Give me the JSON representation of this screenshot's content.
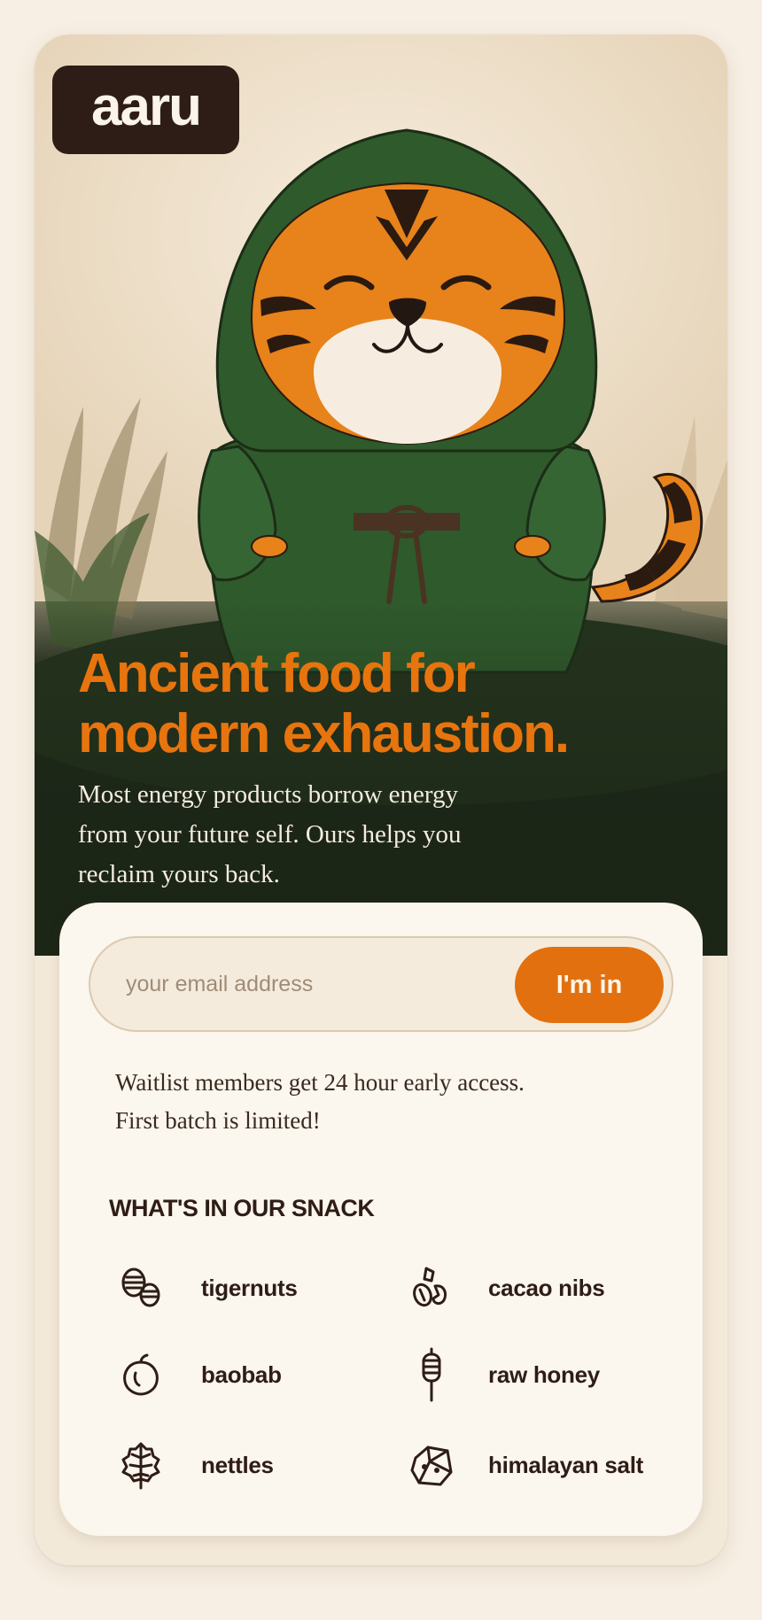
{
  "brand": {
    "logo_text": "aaru"
  },
  "hero": {
    "headline_line1": "Ancient food for",
    "headline_line2": "modern exhaustion.",
    "subcopy_line1": "Most energy products borrow energy",
    "subcopy_line2": "from your future self. Ours helps you",
    "subcopy_line3": "reclaim yours back.",
    "illustration": "tiger-in-green-hoodie"
  },
  "signup": {
    "email_placeholder": "your email address",
    "email_value": "",
    "cta_label": "I'm in",
    "note_line1": "Waitlist members get 24 hour early access.",
    "note_line2": "First batch is limited!"
  },
  "ingredients": {
    "title": "WHAT'S IN OUR SNACK",
    "items": [
      {
        "label": "tigernuts",
        "icon": "tigernuts-icon"
      },
      {
        "label": "cacao nibs",
        "icon": "cacao-nibs-icon"
      },
      {
        "label": "baobab",
        "icon": "baobab-icon"
      },
      {
        "label": "raw honey",
        "icon": "honey-dipper-icon"
      },
      {
        "label": "nettles",
        "icon": "nettle-leaf-icon"
      },
      {
        "label": "himalayan salt",
        "icon": "salt-crystal-icon"
      }
    ]
  },
  "colors": {
    "accent_orange": "#e8740e",
    "dark_brown": "#2e1d16",
    "forest_green": "#2f5a2c",
    "cream": "#fbf6ee"
  }
}
